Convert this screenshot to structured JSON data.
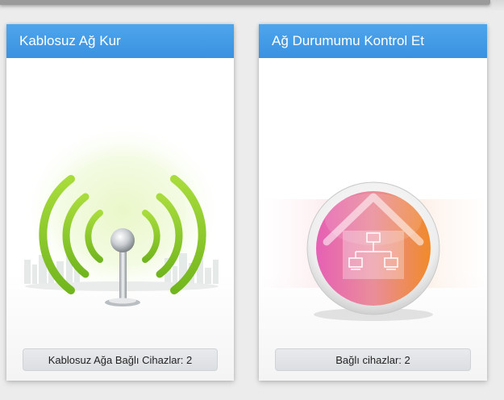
{
  "cards": [
    {
      "title": "Kablosuz Ağ Kur",
      "icon": "wireless-antenna-icon",
      "footer_label": "Kablosuz Ağa Bağlı Cihazlar: 2"
    },
    {
      "title": "Ağ Durumumu Kontrol Et",
      "icon": "home-network-icon",
      "footer_label": "Bağlı cihazlar: 2"
    }
  ],
  "colors": {
    "header_blue": "#3a91e0",
    "wifi_green": "#8ccf2e",
    "network_pink": "#e86aa8",
    "network_orange": "#ef8a33"
  }
}
